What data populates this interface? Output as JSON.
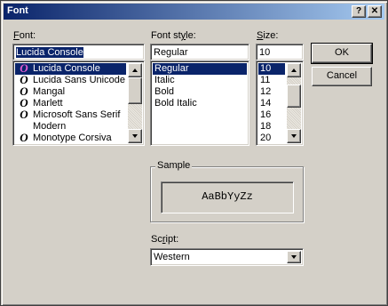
{
  "window": {
    "title": "Font",
    "help_label": "?",
    "close_label": "✕"
  },
  "font": {
    "label_prefix": "F",
    "label_rest": "ont:",
    "value": "Lucida Console",
    "items": [
      {
        "label": "Lucida Console",
        "icon": "opentype-icon",
        "selected": true
      },
      {
        "label": "Lucida Sans Unicode",
        "icon": "opentype-icon"
      },
      {
        "label": "Mangal",
        "icon": "opentype-icon"
      },
      {
        "label": "Marlett",
        "icon": "opentype-icon"
      },
      {
        "label": "Microsoft Sans Serif",
        "icon": "opentype-icon"
      },
      {
        "label": "Modern",
        "icon": ""
      },
      {
        "label": "Monotype Corsiva",
        "icon": "opentype-icon"
      }
    ]
  },
  "style": {
    "label_prefix": "Font st",
    "label_u": "y",
    "label_rest": "le:",
    "value": "Regular",
    "items": [
      {
        "label": "Regular",
        "selected": true
      },
      {
        "label": "Italic"
      },
      {
        "label": "Bold"
      },
      {
        "label": "Bold Italic"
      }
    ]
  },
  "size": {
    "label_prefix": "",
    "label_u": "S",
    "label_rest": "ize:",
    "value": "10",
    "items": [
      {
        "label": "10",
        "selected": true
      },
      {
        "label": "11"
      },
      {
        "label": "12"
      },
      {
        "label": "14"
      },
      {
        "label": "16"
      },
      {
        "label": "18"
      },
      {
        "label": "20"
      }
    ]
  },
  "buttons": {
    "ok": "OK",
    "cancel": "Cancel"
  },
  "sample": {
    "label": "Sample",
    "text": "AaBbYyZz"
  },
  "script": {
    "label_prefix": "Sc",
    "label_u": "r",
    "label_rest": "ipt:",
    "value": "Western"
  },
  "colors": {
    "selection": "#0a246a",
    "face": "#d4d0c8"
  }
}
